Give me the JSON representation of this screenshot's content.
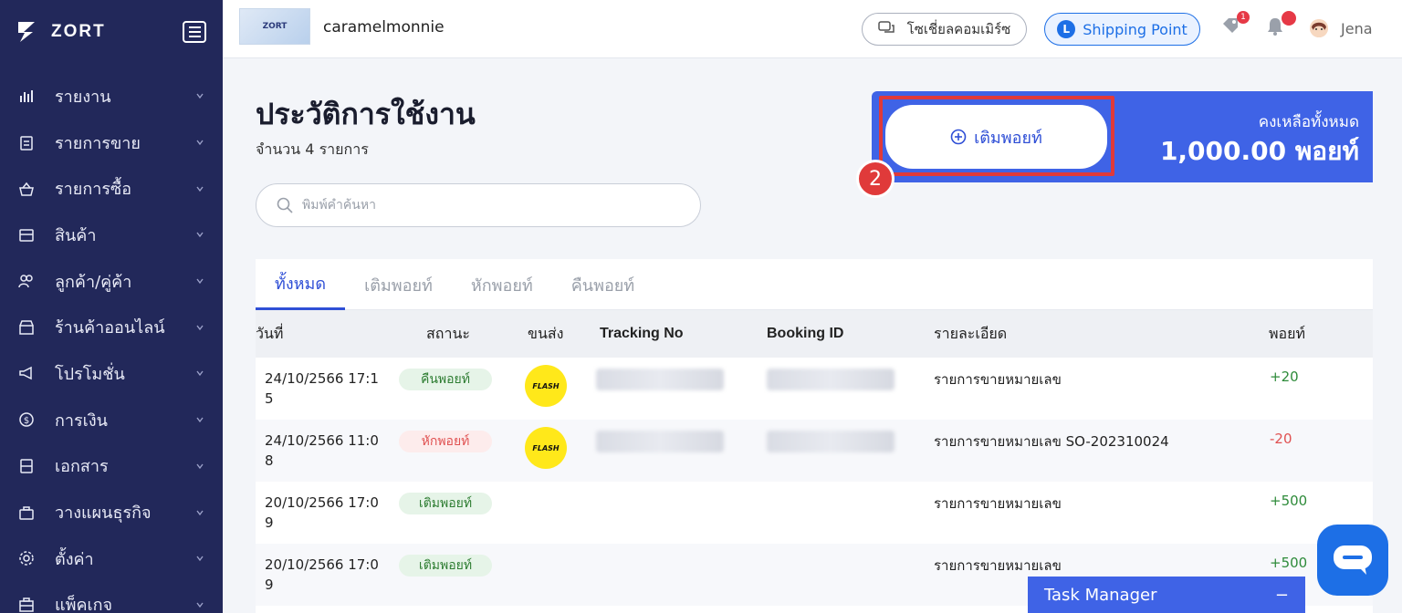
{
  "sidebar": {
    "brand": "ZORT",
    "items": [
      {
        "label": "รายงาน",
        "icon": "bar-chart-icon"
      },
      {
        "label": "รายการขาย",
        "icon": "clipboard-icon"
      },
      {
        "label": "รายการซื้อ",
        "icon": "basket-icon"
      },
      {
        "label": "สินค้า",
        "icon": "box-icon"
      },
      {
        "label": "ลูกค้า/คู่ค้า",
        "icon": "users-icon"
      },
      {
        "label": "ร้านค้าออนไลน์",
        "icon": "store-icon"
      },
      {
        "label": "โปรโมชั่น",
        "icon": "megaphone-icon"
      },
      {
        "label": "การเงิน",
        "icon": "dollar-icon"
      },
      {
        "label": "เอกสาร",
        "icon": "document-icon"
      },
      {
        "label": "วางแผนธุรกิจ",
        "icon": "briefcase-icon"
      },
      {
        "label": "ตั้งค่า",
        "icon": "gear-icon"
      },
      {
        "label": "แพ็คเกจ",
        "icon": "package-icon"
      }
    ]
  },
  "topbar": {
    "shop_thumb_text": "ZORT",
    "shop_name": "caramelmonnie",
    "social_label": "โซเชี่ยลคอมเมิร์ซ",
    "shipping_badge": "L",
    "shipping_label": "Shipping Point",
    "notification_count": "1",
    "user_name": "Jena"
  },
  "main": {
    "title": "ประวัติการใช้งาน",
    "count_text": "จำนวน 4 รายการ",
    "search_placeholder": "พิมพ์คำค้นหา",
    "topup_label": "เติมพอยท์",
    "balance_label": "คงเหลือทั้งหมด",
    "balance_value": "1,000.00 พอยท์",
    "step_number": "2"
  },
  "tabs": [
    {
      "label": "ทั้งหมด",
      "active": true
    },
    {
      "label": "เติมพอยท์",
      "active": false
    },
    {
      "label": "หักพอยท์",
      "active": false
    },
    {
      "label": "คืนพอยท์",
      "active": false
    }
  ],
  "table": {
    "headers": {
      "date": "วันที่",
      "status": "สถานะ",
      "carrier": "ขนส่ง",
      "tracking": "Tracking No",
      "booking": "Booking ID",
      "detail": "รายละเอียด",
      "points": "พอยท์"
    },
    "rows": [
      {
        "date_line1": "24/10/2566 17:1",
        "date_line2": "5",
        "status": "คืนพอยท์",
        "status_type": "green",
        "carrier_logo": "FLASH",
        "detail": "รายการขายหมายเลข",
        "points": "+20",
        "points_type": "pos"
      },
      {
        "date_line1": "24/10/2566 11:0",
        "date_line2": "8",
        "status": "หักพอยท์",
        "status_type": "red",
        "carrier_logo": "FLASH",
        "detail": "รายการขายหมายเลข SO-202310024",
        "points": "-20",
        "points_type": "neg"
      },
      {
        "date_line1": "20/10/2566 17:0",
        "date_line2": "9",
        "status": "เติมพอยท์",
        "status_type": "green",
        "carrier_logo": "",
        "detail": "รายการขายหมายเลข",
        "points": "+500",
        "points_type": "pos"
      },
      {
        "date_line1": "20/10/2566 17:0",
        "date_line2": "9",
        "status": "เติมพอยท์",
        "status_type": "green",
        "carrier_logo": "",
        "detail": "รายการขายหมายเลข",
        "points": "+500",
        "points_type": "pos"
      }
    ]
  },
  "task_manager": {
    "label": "Task Manager",
    "collapse_symbol": "−"
  },
  "colors": {
    "sidebar_bg": "#22285a",
    "accent_blue": "#3f63e6",
    "highlight_red": "#e03a3a",
    "positive_green": "#2e8b3a",
    "negative_red": "#e05252"
  }
}
